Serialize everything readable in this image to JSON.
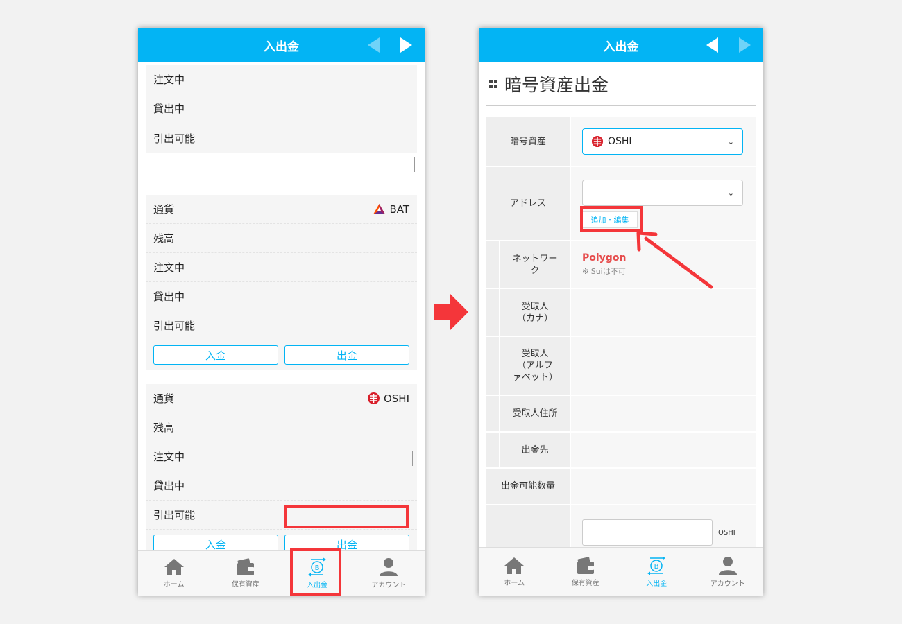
{
  "left": {
    "header": {
      "title": "入出金"
    },
    "card1": {
      "rows": [
        "注文中",
        "貸出中",
        "引出可能"
      ]
    },
    "card2": {
      "currency_label": "通貨",
      "currency": "BAT",
      "rows": [
        "残高",
        "注文中",
        "貸出中",
        "引出可能"
      ],
      "deposit_label": "入金",
      "withdraw_label": "出金"
    },
    "card3": {
      "currency_label": "通貨",
      "currency": "OSHI",
      "rows": [
        "残高",
        "注文中",
        "貸出中",
        "引出可能"
      ],
      "deposit_label": "入金",
      "withdraw_label": "出金"
    }
  },
  "right": {
    "header": {
      "title": "入出金"
    },
    "page_title": "暗号資産出金",
    "form": {
      "asset_label": "暗号資産",
      "asset_value": "OSHI",
      "address_label": "アドレス",
      "address_value": "",
      "add_edit_label": "追加・編集",
      "network_label": "ネットワーク",
      "network_value": "Polygon",
      "network_note": "※ Suiは不可",
      "recipient_kana_label": "受取人\n（カナ）",
      "recipient_alpha_label": "受取人\n（アルファベット）",
      "recipient_address_label": "受取人住所",
      "destination_label": "出金先",
      "available_qty_label": "出金可能数量",
      "qty_unit": "OSHI"
    }
  },
  "tabs": [
    {
      "label": "ホーム",
      "icon": "home-icon"
    },
    {
      "label": "保有資産",
      "icon": "wallet-icon"
    },
    {
      "label": "入出金",
      "icon": "bitcoin-transfer-icon",
      "active": true
    },
    {
      "label": "アカウント",
      "icon": "account-icon"
    }
  ],
  "colors": {
    "accent": "#03b4f4",
    "highlight": "#f4363a",
    "network": "#e64c4c"
  }
}
